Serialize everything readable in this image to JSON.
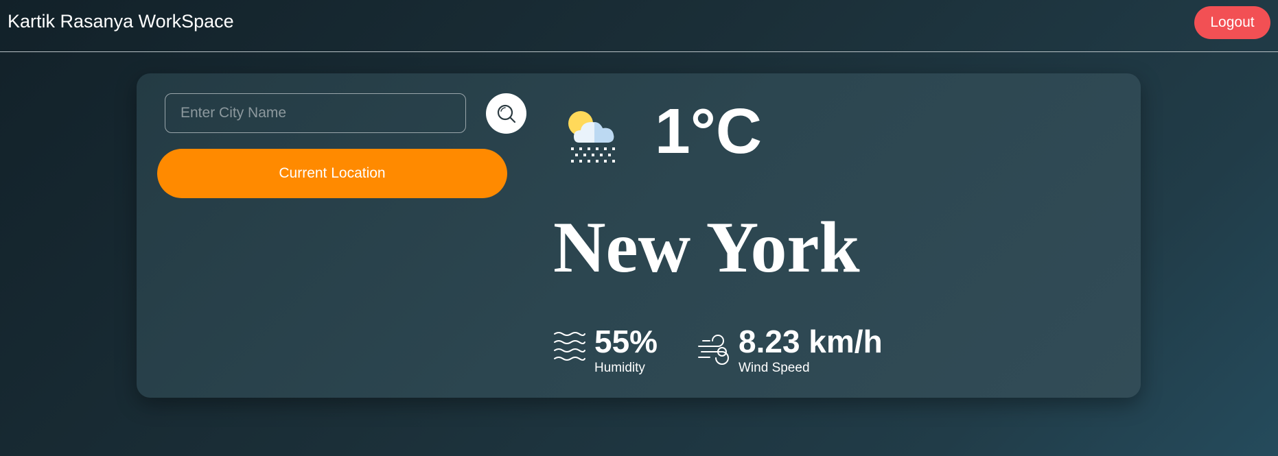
{
  "header": {
    "title": "Kartik Rasanya WorkSpace",
    "logout_label": "Logout"
  },
  "search": {
    "placeholder": "Enter City Name",
    "value": "",
    "search_icon": "search-icon",
    "current_location_label": "Current Location"
  },
  "weather": {
    "icon": "snow-cloud-sun-icon",
    "temperature": "1°C",
    "city": "New York",
    "humidity": {
      "icon": "humidity-waves-icon",
      "value": "55%",
      "label": "Humidity"
    },
    "wind": {
      "icon": "wind-icon",
      "value": "8.23 km/h",
      "label": "Wind Speed"
    }
  },
  "colors": {
    "logout": "#f25054",
    "location_button": "#ff8a00",
    "card": "#2c4650",
    "background": "#1b2f38"
  }
}
